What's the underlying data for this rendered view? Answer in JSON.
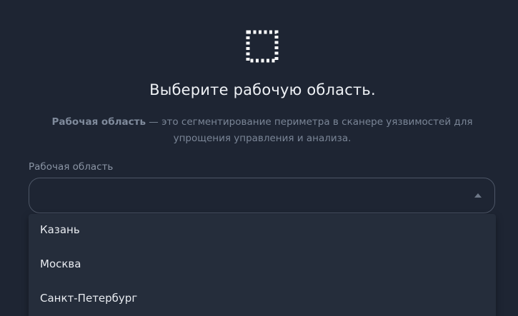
{
  "header": {
    "icon": "dotted-square-icon",
    "title": "Выберите рабочую область."
  },
  "description": {
    "strong": "Рабочая область",
    "rest": " — это сегментирование периметра в сканере уязвимостей для упрощения управления и анализа."
  },
  "workspace_select": {
    "label": "Рабочая область",
    "value": "",
    "state": "expanded",
    "options": [
      {
        "label": "Казань"
      },
      {
        "label": "Москва"
      },
      {
        "label": "Санкт-Петербург"
      }
    ]
  },
  "colors": {
    "background": "#1e2533",
    "dropdown_background": "#252d3b",
    "border": "#4d5666",
    "text_primary": "#eef1f5",
    "text_muted": "#7a8596"
  }
}
